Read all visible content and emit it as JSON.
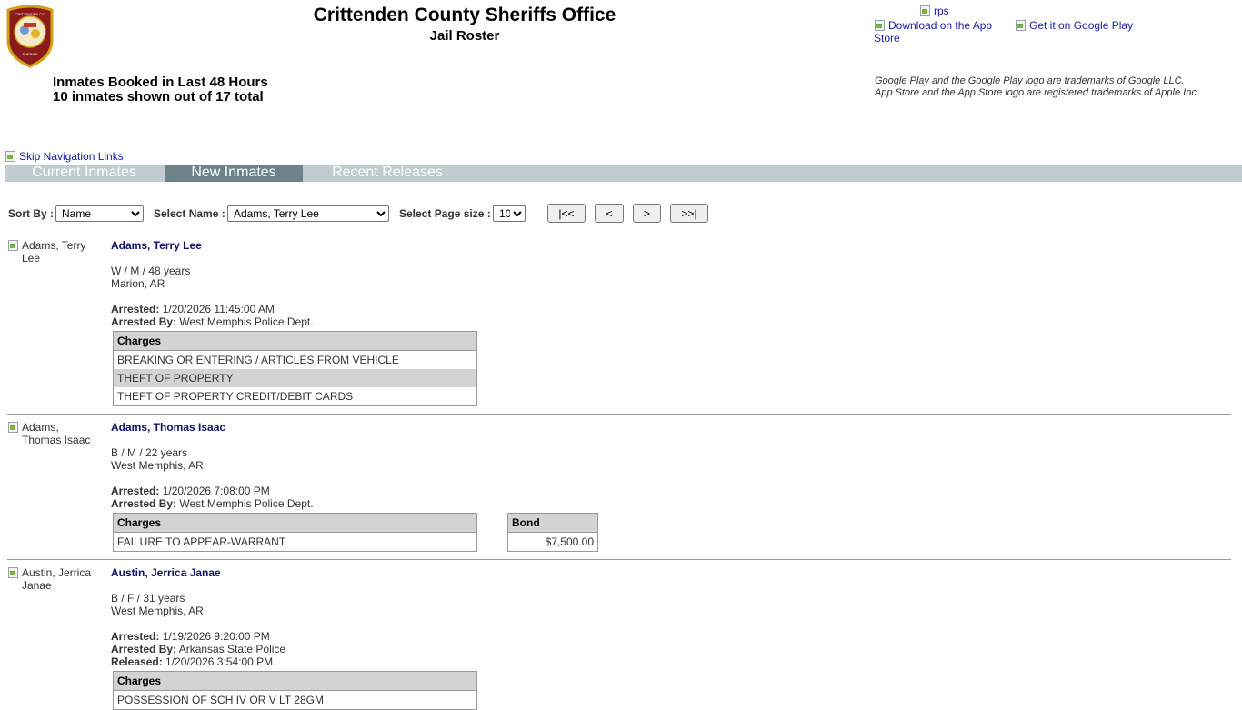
{
  "header": {
    "title": "Crittenden County Sheriffs Office",
    "subtitle": "Jail Roster",
    "badge_text_top": "CRITTENDEN CO",
    "badge_text_bottom": "SHERIFF",
    "booked_title": "Inmates Booked in Last 48 Hours",
    "booked_count": "10 inmates shown out of 17 total",
    "rps_alt": "rps",
    "appstore_alt": "Download on the App Store",
    "gplay_alt": "Get it on Google Play",
    "trademark_1": "Google Play and the Google Play logo are trademarks of Google LLC.",
    "trademark_2": "App Store and the App Store logo are registered trademarks of Apple Inc."
  },
  "skipnav_alt": "Skip Navigation Links",
  "tabs": [
    "Current Inmates",
    "New Inmates",
    "Recent Releases"
  ],
  "controls": {
    "sort_label": "Sort By :",
    "sort_value": "Name",
    "name_label": "Select Name :",
    "name_value": "Adams, Terry Lee",
    "size_label": "Select Page size :",
    "size_value": "10",
    "first": "|<<",
    "prev": "<",
    "next": ">",
    "last": ">>|"
  },
  "inmates": [
    {
      "photo_alt_1": "Adams, Terry",
      "photo_alt_2": "Lee",
      "name": "Adams, Terry Lee",
      "demo": "W / M / 48 years",
      "city": "Marion, AR",
      "arrested_label": "Arrested:",
      "arrested": "1/20/2026 11:45:00 AM",
      "by_label": "Arrested By:",
      "by": "West Memphis Police Dept.",
      "charges_header": "Charges",
      "charges": [
        "BREAKING OR ENTERING / ARTICLES FROM VEHICLE",
        "THEFT OF PROPERTY",
        "THEFT OF PROPERTY CREDIT/DEBIT CARDS"
      ]
    },
    {
      "photo_alt_1": "Adams,",
      "photo_alt_2": "Thomas Isaac",
      "name": "Adams, Thomas Isaac",
      "demo": "B / M / 22 years",
      "city": "West Memphis, AR",
      "arrested_label": "Arrested:",
      "arrested": "1/20/2026 7:08:00 PM",
      "by_label": "Arrested By:",
      "by": "West Memphis Police Dept.",
      "charges_header": "Charges",
      "charges": [
        "FAILURE TO APPEAR-WARRANT"
      ],
      "bond_header": "Bond",
      "bond": "$7,500.00"
    },
    {
      "photo_alt_1": "Austin, Jerrica",
      "photo_alt_2": "Janae",
      "name": "Austin, Jerrica Janae",
      "demo": "B / F / 31 years",
      "city": "West Memphis, AR",
      "arrested_label": "Arrested:",
      "arrested": "1/19/2026 9:20:00 PM",
      "by_label": "Arrested By:",
      "by": "Arkansas State Police",
      "released_label": "Released:",
      "released": "1/20/2026 3:54:00 PM",
      "charges_header": "Charges",
      "charges": [
        "POSSESSION OF SCH IV OR V LT 28GM"
      ]
    }
  ]
}
